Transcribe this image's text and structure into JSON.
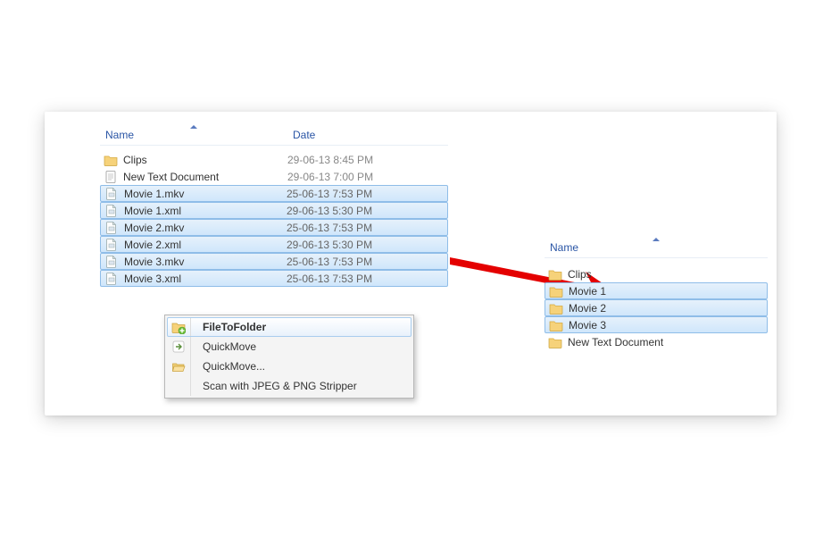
{
  "left": {
    "columns": {
      "name": "Name",
      "date": "Date"
    },
    "rows": [
      {
        "icon": "folder",
        "name": "Clips",
        "date": "29-06-13 8:45 PM",
        "selected": false
      },
      {
        "icon": "doc",
        "name": "New Text Document",
        "date": "29-06-13 7:00 PM",
        "selected": false
      },
      {
        "icon": "file",
        "name": "Movie 1.mkv",
        "date": "25-06-13 7:53 PM",
        "selected": true
      },
      {
        "icon": "file",
        "name": "Movie 1.xml",
        "date": "29-06-13 5:30 PM",
        "selected": true
      },
      {
        "icon": "file",
        "name": "Movie 2.mkv",
        "date": "25-06-13 7:53 PM",
        "selected": true
      },
      {
        "icon": "file",
        "name": "Movie 2.xml",
        "date": "29-06-13 5:30 PM",
        "selected": true
      },
      {
        "icon": "file",
        "name": "Movie 3.mkv",
        "date": "25-06-13 7:53 PM",
        "selected": true
      },
      {
        "icon": "file",
        "name": "Movie 3.xml",
        "date": "25-06-13 7:53 PM",
        "selected": true
      }
    ]
  },
  "context_menu": {
    "items": [
      {
        "icon": "folder-add",
        "label": "FileToFolder",
        "hover": true
      },
      {
        "icon": "arrow-right",
        "label": "QuickMove",
        "hover": false
      },
      {
        "icon": "folder-open",
        "label": "QuickMove...",
        "hover": false
      },
      {
        "icon": "",
        "label": "Scan with JPEG & PNG Stripper",
        "hover": false
      }
    ]
  },
  "right": {
    "columns": {
      "name": "Name"
    },
    "rows": [
      {
        "icon": "folder",
        "name": "Clips",
        "selected": false
      },
      {
        "icon": "folder",
        "name": "Movie 1",
        "selected": true
      },
      {
        "icon": "folder",
        "name": "Movie 2",
        "selected": true
      },
      {
        "icon": "folder",
        "name": "Movie 3",
        "selected": true
      },
      {
        "icon": "folder",
        "name": "New Text Document",
        "selected": false
      }
    ]
  }
}
